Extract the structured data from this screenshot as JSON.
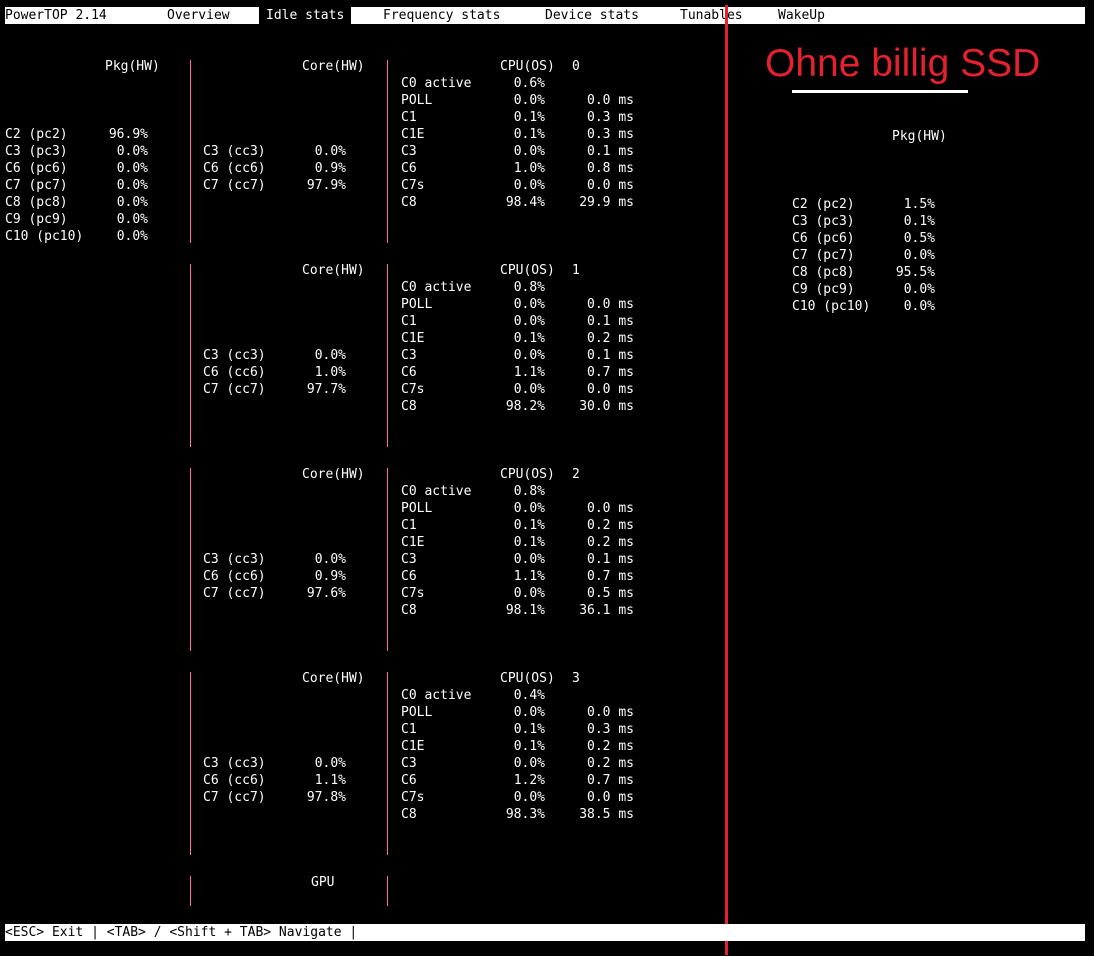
{
  "tabs": [
    {
      "label": "PowerTOP 2.14",
      "active": false
    },
    {
      "label": "Overview",
      "active": false
    },
    {
      "label": "Idle stats",
      "active": true
    },
    {
      "label": "Frequency stats",
      "active": false
    },
    {
      "label": "Device stats",
      "active": false
    },
    {
      "label": "Tunables",
      "active": false
    },
    {
      "label": "WakeUp",
      "active": false
    }
  ],
  "pkg": {
    "header": "Pkg(HW)",
    "rows": [
      [
        "C2 (pc2)",
        "96.9%"
      ],
      [
        "C3 (pc3)",
        "0.0%"
      ],
      [
        "C6 (pc6)",
        "0.0%"
      ],
      [
        "C7 (pc7)",
        "0.0%"
      ],
      [
        "C8 (pc8)",
        "0.0%"
      ],
      [
        "C9 (pc9)",
        "0.0%"
      ],
      [
        "C10 (pc10)",
        "0.0%"
      ]
    ]
  },
  "cores": [
    {
      "header": "Core(HW)",
      "rows": [
        [
          "C3 (cc3)",
          "0.0%"
        ],
        [
          "C6 (cc6)",
          "0.9%"
        ],
        [
          "C7 (cc7)",
          "97.9%"
        ]
      ]
    },
    {
      "header": "Core(HW)",
      "rows": [
        [
          "C3 (cc3)",
          "0.0%"
        ],
        [
          "C6 (cc6)",
          "1.0%"
        ],
        [
          "C7 (cc7)",
          "97.7%"
        ]
      ]
    },
    {
      "header": "Core(HW)",
      "rows": [
        [
          "C3 (cc3)",
          "0.0%"
        ],
        [
          "C6 (cc6)",
          "0.9%"
        ],
        [
          "C7 (cc7)",
          "97.6%"
        ]
      ]
    },
    {
      "header": "Core(HW)",
      "rows": [
        [
          "C3 (cc3)",
          "0.0%"
        ],
        [
          "C6 (cc6)",
          "1.1%"
        ],
        [
          "C7 (cc7)",
          "97.8%"
        ]
      ]
    }
  ],
  "cpus": [
    {
      "header": "CPU(OS)",
      "id": "0",
      "active": [
        "C0 active",
        "0.6%"
      ],
      "rows": [
        [
          "POLL",
          "0.0%",
          "0.0 ms"
        ],
        [
          "C1",
          "0.1%",
          "0.3 ms"
        ],
        [
          "C1E",
          "0.1%",
          "0.3 ms"
        ],
        [
          "C3",
          "0.0%",
          "0.1 ms"
        ],
        [
          "C6",
          "1.0%",
          "0.8 ms"
        ],
        [
          "C7s",
          "0.0%",
          "0.0 ms"
        ],
        [
          "C8",
          "98.4%",
          "29.9 ms"
        ]
      ]
    },
    {
      "header": "CPU(OS)",
      "id": "1",
      "active": [
        "C0 active",
        "0.8%"
      ],
      "rows": [
        [
          "POLL",
          "0.0%",
          "0.0 ms"
        ],
        [
          "C1",
          "0.0%",
          "0.1 ms"
        ],
        [
          "C1E",
          "0.1%",
          "0.2 ms"
        ],
        [
          "C3",
          "0.0%",
          "0.1 ms"
        ],
        [
          "C6",
          "1.1%",
          "0.7 ms"
        ],
        [
          "C7s",
          "0.0%",
          "0.0 ms"
        ],
        [
          "C8",
          "98.2%",
          "30.0 ms"
        ]
      ]
    },
    {
      "header": "CPU(OS)",
      "id": "2",
      "active": [
        "C0 active",
        "0.8%"
      ],
      "rows": [
        [
          "POLL",
          "0.0%",
          "0.0 ms"
        ],
        [
          "C1",
          "0.1%",
          "0.2 ms"
        ],
        [
          "C1E",
          "0.1%",
          "0.2 ms"
        ],
        [
          "C3",
          "0.0%",
          "0.1 ms"
        ],
        [
          "C6",
          "1.1%",
          "0.7 ms"
        ],
        [
          "C7s",
          "0.0%",
          "0.5 ms"
        ],
        [
          "C8",
          "98.1%",
          "36.1 ms"
        ]
      ]
    },
    {
      "header": "CPU(OS)",
      "id": "3",
      "active": [
        "C0 active",
        "0.4%"
      ],
      "rows": [
        [
          "POLL",
          "0.0%",
          "0.0 ms"
        ],
        [
          "C1",
          "0.1%",
          "0.3 ms"
        ],
        [
          "C1E",
          "0.1%",
          "0.2 ms"
        ],
        [
          "C3",
          "0.0%",
          "0.2 ms"
        ],
        [
          "C6",
          "1.2%",
          "0.7 ms"
        ],
        [
          "C7s",
          "0.0%",
          "0.0 ms"
        ],
        [
          "C8",
          "98.3%",
          "38.5 ms"
        ]
      ]
    }
  ],
  "gpu": {
    "label": "GPU"
  },
  "footer": {
    "text": "<ESC> Exit | <TAB> / <Shift + TAB> Navigate |"
  },
  "annotation": {
    "text": "Ohne billig SSD",
    "color": "#e3212f"
  },
  "pkg_compare": {
    "header": "Pkg(HW)",
    "rows": [
      [
        "C2 (pc2)",
        "1.5%"
      ],
      [
        "C3 (pc3)",
        "0.1%"
      ],
      [
        "C6 (pc6)",
        "0.5%"
      ],
      [
        "C7 (pc7)",
        "0.0%"
      ],
      [
        "C8 (pc8)",
        "95.5%"
      ],
      [
        "C9 (pc9)",
        "0.0%"
      ],
      [
        "C10 (pc10)",
        "0.0%"
      ]
    ]
  }
}
